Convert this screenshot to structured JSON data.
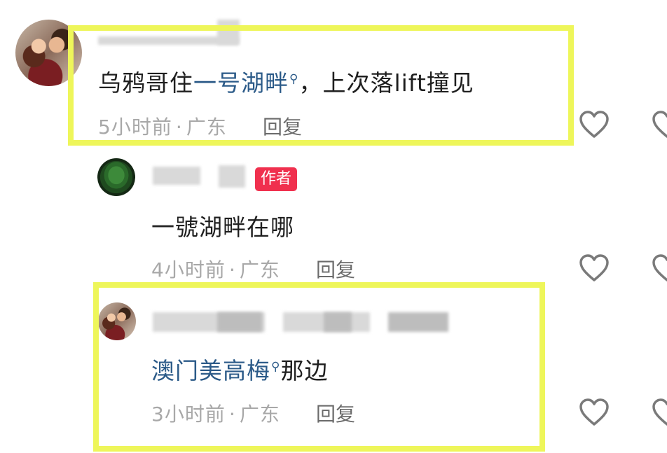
{
  "comments": [
    {
      "text_before": "乌鸦哥住",
      "link": "一号湖畔",
      "text_after": "，上次落lift撞见",
      "time": "5小时前",
      "region": "广东",
      "reply_label": "回复"
    },
    {
      "badge": "作者",
      "text": "一號湖畔在哪",
      "time": "4小时前",
      "region": "广东",
      "reply_label": "回复"
    },
    {
      "link": "澳门美高梅",
      "text_after": "那边",
      "time": "3小时前",
      "region": "广东",
      "reply_label": "回复"
    }
  ],
  "separator": "·",
  "colors": {
    "highlight": "#eef65a",
    "link": "#2b5a88",
    "badge": "#f0304e",
    "meta": "#a8a8a8"
  },
  "icons": [
    "heart-icon",
    "search-icon"
  ]
}
